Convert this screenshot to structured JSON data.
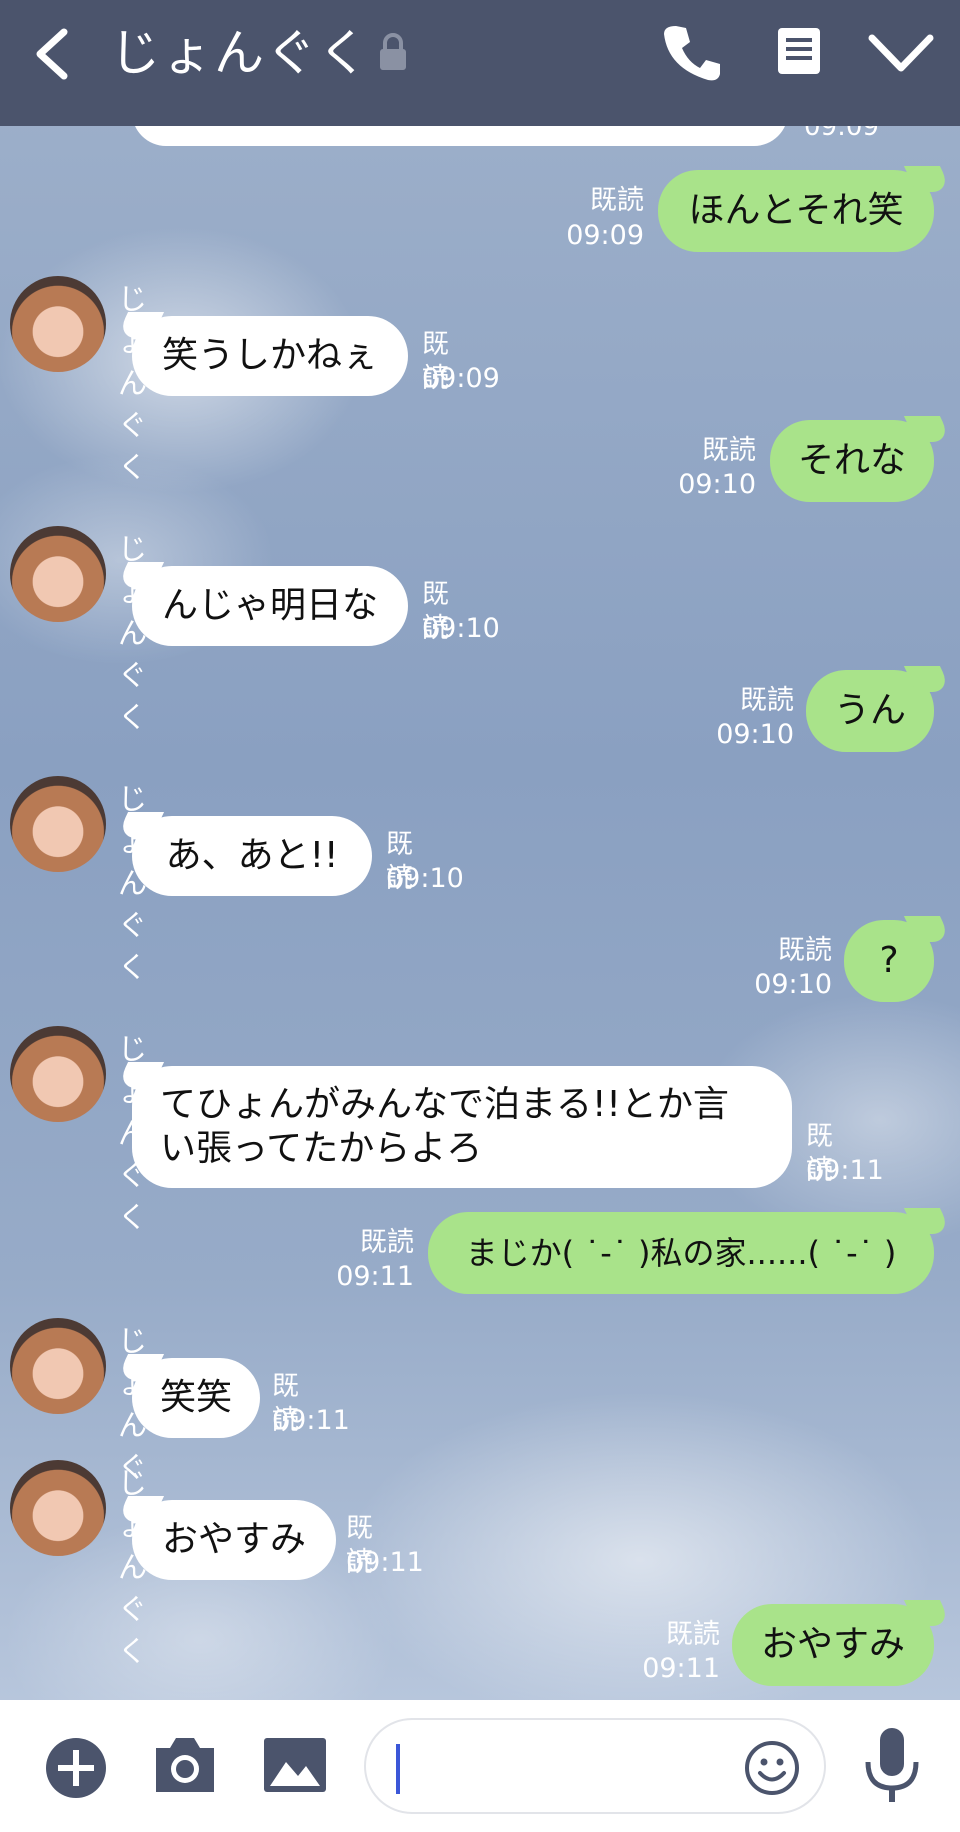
{
  "header": {
    "title": "じょんぐく",
    "back_icon": "chevron-left-icon",
    "lock_icon": "lock-icon",
    "call_icon": "phone-icon",
    "notes_icon": "notes-icon",
    "menu_icon": "chevron-down-icon"
  },
  "partial_top": {
    "time": "09:09"
  },
  "messages": [
    {
      "dir": "out",
      "text": "ほんとそれ笑",
      "read": "既読",
      "time": "09:09"
    },
    {
      "dir": "in",
      "sender": "じょんぐく",
      "text": "笑うしかねぇ",
      "read": "既読",
      "time": "09:09"
    },
    {
      "dir": "out",
      "text": "それな",
      "read": "既読",
      "time": "09:10"
    },
    {
      "dir": "in",
      "sender": "じょんぐく",
      "text": "んじゃ明日な",
      "read": "既読",
      "time": "09:10"
    },
    {
      "dir": "out",
      "text": "うん",
      "read": "既読",
      "time": "09:10"
    },
    {
      "dir": "in",
      "sender": "じょんぐく",
      "text": "あ、あと!!",
      "read": "既読",
      "time": "09:10"
    },
    {
      "dir": "out",
      "text": "?",
      "read": "既読",
      "time": "09:10"
    },
    {
      "dir": "in",
      "sender": "じょんぐく",
      "text_line1": "てひょんがみんなで泊まる!!とか言",
      "text_line2": "い張ってたからよろ",
      "read": "既読",
      "time": "09:11"
    },
    {
      "dir": "out",
      "text": "まじか( ˙-˙ )私の家......( ˙-˙ )",
      "read": "既読",
      "time": "09:11"
    },
    {
      "dir": "in",
      "sender": "じょんぐく",
      "text": "笑笑",
      "read": "既読",
      "time": "09:11"
    },
    {
      "dir": "in",
      "sender": "じょんぐく",
      "text": "おやすみ",
      "read": "既読",
      "time": "09:11"
    },
    {
      "dir": "out",
      "text": "おやすみ",
      "read": "既読",
      "time": "09:11"
    }
  ],
  "input_bar": {
    "plus_icon": "plus-icon",
    "camera_icon": "camera-icon",
    "image_icon": "image-icon",
    "emoji_icon": "emoji-icon",
    "mic_icon": "microphone-icon",
    "input_value": "",
    "input_placeholder": ""
  },
  "colors": {
    "header_bg": "#4b546c",
    "bubble_out": "#a9e38a",
    "bubble_in": "#ffffff",
    "caret": "#3b57d8"
  }
}
